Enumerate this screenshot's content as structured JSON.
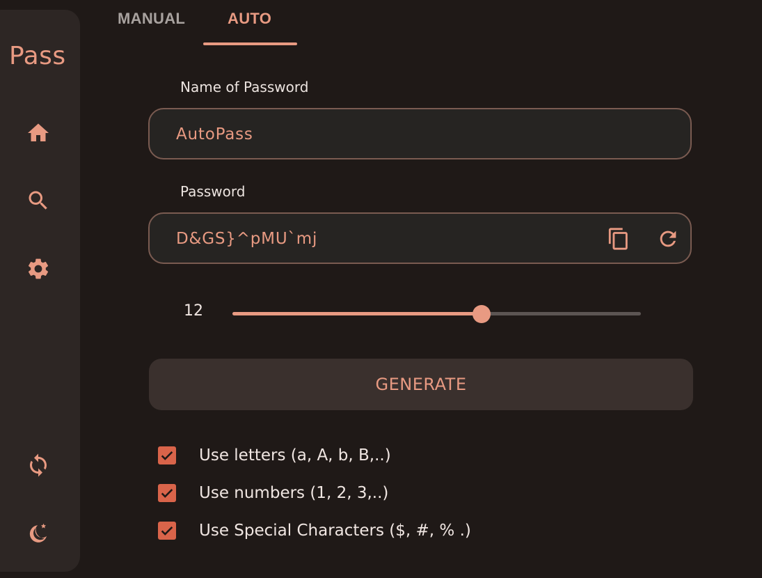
{
  "app": {
    "brand": "Pass",
    "accent_color": "#e89a82"
  },
  "sidebar": {
    "items": [
      {
        "icon": "home-icon"
      },
      {
        "icon": "search-icon"
      },
      {
        "icon": "settings-icon"
      },
      {
        "icon": "sync-icon"
      },
      {
        "icon": "theme-moon-icon"
      }
    ]
  },
  "tabs": [
    {
      "label": "MANUAL",
      "active": false
    },
    {
      "label": "AUTO",
      "active": true
    }
  ],
  "form": {
    "name_label": "Name of Password",
    "name_value": "AutoPass",
    "password_label": "Password",
    "password_value": "D&GS}^pMU`mj",
    "copy_icon": "copy-icon",
    "refresh_icon": "refresh-icon"
  },
  "length": {
    "value": "12",
    "slider_fraction": 0.61
  },
  "generate_label": "GENERATE",
  "options": [
    {
      "label": "Use letters (a, A, b, B,..)",
      "checked": true
    },
    {
      "label": "Use numbers (1, 2, 3,..)",
      "checked": true
    },
    {
      "label": "Use Special Characters ($, #, % .)",
      "checked": true
    }
  ]
}
